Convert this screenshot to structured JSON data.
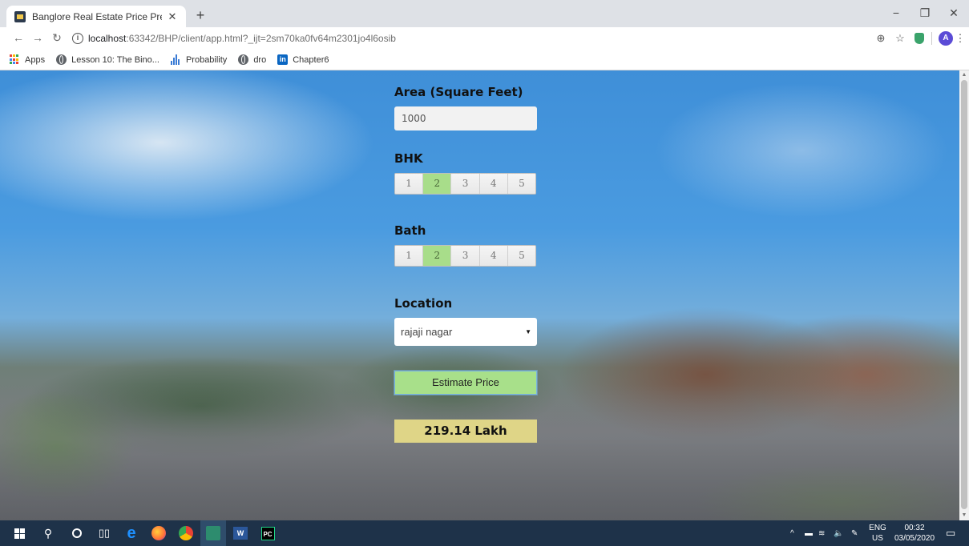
{
  "browser": {
    "tab_title": "Banglore Real Estate Price Predic",
    "tab_close": "✕",
    "new_tab": "+",
    "url_host": "localhost",
    "url_rest": ":63342/BHP/client/app.html?_ijt=2sm70ka0fv64m2301jo4l6osib",
    "profile_initial": "A",
    "window_minimize": "−",
    "window_restore": "❐",
    "window_close": "✕",
    "bookmarks": [
      {
        "label": "Apps",
        "icon": "apps-grid-icon"
      },
      {
        "label": "Lesson 10: The Bino...",
        "icon": "globe-icon"
      },
      {
        "label": "Probability",
        "icon": "bar-chart-icon"
      },
      {
        "label": "dro",
        "icon": "globe-icon"
      },
      {
        "label": "Chapter6",
        "icon": "linkedin-icon"
      }
    ]
  },
  "form": {
    "area_label": "Area (Square Feet)",
    "area_value": "1000",
    "bhk_label": "BHK",
    "bhk_options": [
      "1",
      "2",
      "3",
      "4",
      "5"
    ],
    "bhk_selected": "2",
    "bath_label": "Bath",
    "bath_options": [
      "1",
      "2",
      "3",
      "4",
      "5"
    ],
    "bath_selected": "2",
    "location_label": "Location",
    "location_value": "rajaji nagar",
    "estimate_button": "Estimate Price",
    "result": "219.14 Lakh"
  },
  "colors": {
    "selected_option": "#a8dd8a",
    "estimate_button": "#a8e08a",
    "result_background": "#dfd587",
    "taskbar": "#1e3249"
  },
  "taskbar": {
    "lang_top": "ENG",
    "lang_bottom": "US",
    "time": "00:32",
    "date": "03/05/2020",
    "apps": [
      "windows-start-icon",
      "search-icon",
      "cortana-icon",
      "task-view-icon",
      "edge-icon",
      "firefox-icon",
      "chrome-icon",
      "jupyter-icon",
      "word-icon",
      "pycharm-icon"
    ]
  }
}
